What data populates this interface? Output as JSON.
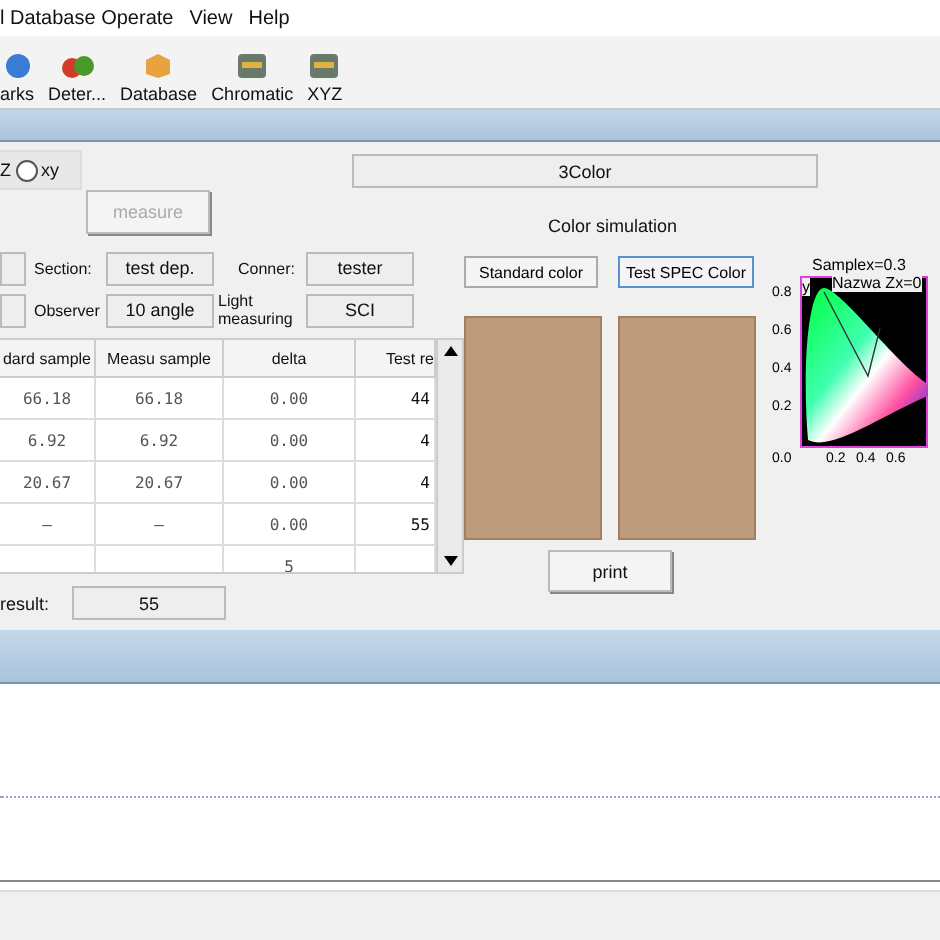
{
  "menu": [
    "l Database Operate",
    "View",
    "Help"
  ],
  "toolbar": [
    {
      "label": "arks",
      "kind": "globe"
    },
    {
      "label": "Deter...",
      "kind": "fruit"
    },
    {
      "label": "Database",
      "kind": "box"
    },
    {
      "label": "Chromatic",
      "kind": "monitor"
    },
    {
      "label": "XYZ",
      "kind": "monitor"
    }
  ],
  "mode": {
    "label": "Z",
    "options": [
      {
        "label": "xy",
        "selected": false
      }
    ]
  },
  "measure_button": {
    "label": "measure",
    "disabled": true
  },
  "info_rows": [
    [
      {
        "label": "Section:",
        "value": "test dep."
      },
      {
        "label": "Conner:",
        "value": "tester"
      }
    ],
    [
      {
        "label": "Observer",
        "value": "10 angle"
      },
      {
        "label": "Light measuring",
        "value": "SCI"
      }
    ]
  ],
  "table": {
    "columns": [
      "dard sample",
      "Measu sample",
      "delta",
      "Test re"
    ],
    "rows": [
      [
        "66.18",
        "66.18",
        "0.00",
        "44"
      ],
      [
        "6.92",
        "6.92",
        "0.00",
        "4"
      ],
      [
        "20.67",
        "20.67",
        "0.00",
        "4"
      ],
      [
        "–",
        "–",
        "0.00",
        "55"
      ],
      [
        "",
        "",
        "5",
        ""
      ]
    ]
  },
  "result": {
    "label": "result:",
    "value": "55"
  },
  "color_name": "3Color",
  "simulation_title": "Color simulation",
  "color_buttons": [
    {
      "label": "Standard color",
      "focused": false
    },
    {
      "label": "Test SPEC Color",
      "focused": true
    }
  ],
  "swatches": [
    {
      "color": "#bd9b7c"
    },
    {
      "color": "#bd9b7c"
    }
  ],
  "chromaticity": {
    "legend": [
      "Samplex=0.3",
      "Nazwa Zx=0"
    ],
    "axis_y": "y",
    "yticks": [
      "0.8",
      "0.6",
      "0.4",
      "0.2"
    ],
    "xticks": [
      "0.0",
      "0.2",
      "0.4",
      "0.6"
    ]
  },
  "print_button": "print"
}
